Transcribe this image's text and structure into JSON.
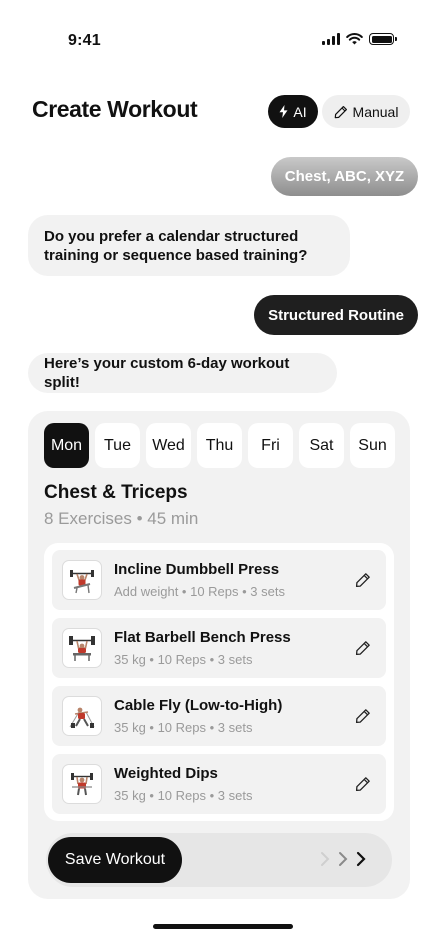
{
  "status_bar": {
    "time": "9:41"
  },
  "header": {
    "title": "Create Workout",
    "mode_ai_label": "AI",
    "mode_manual_label": "Manual"
  },
  "chat": {
    "user_message_1": "Chest, ABC, XYZ",
    "bot_message_1": "Do you prefer a calendar structured training or sequence based training?",
    "user_message_2": "Structured Routine",
    "bot_message_2": "Here’s your custom 6-day workout split!"
  },
  "workout": {
    "days": [
      "Mon",
      "Tue",
      "Wed",
      "Thu",
      "Fri",
      "Sat",
      "Sun"
    ],
    "active_day": "Mon",
    "split_title": "Chest & Triceps",
    "split_meta": "8 Exercises • 45 min",
    "exercises": [
      {
        "name": "Incline Dumbbell Press",
        "detail": "Add weight • 10 Reps • 3 sets",
        "icon": "incline-press-icon"
      },
      {
        "name": "Flat Barbell Bench Press",
        "detail": "35 kg • 10 Reps • 3 sets",
        "icon": "bench-press-icon"
      },
      {
        "name": "Cable Fly (Low-to-High)",
        "detail": "35 kg • 10 Reps • 3 sets",
        "icon": "cable-fly-icon"
      },
      {
        "name": "Weighted Dips",
        "detail": "35 kg • 10 Reps • 3 sets",
        "icon": "dips-icon"
      }
    ],
    "save_label": "Save Workout"
  },
  "colors": {
    "accent": "#111111",
    "surface": "#f2f2f2",
    "muted_text": "#9a9a9a"
  }
}
